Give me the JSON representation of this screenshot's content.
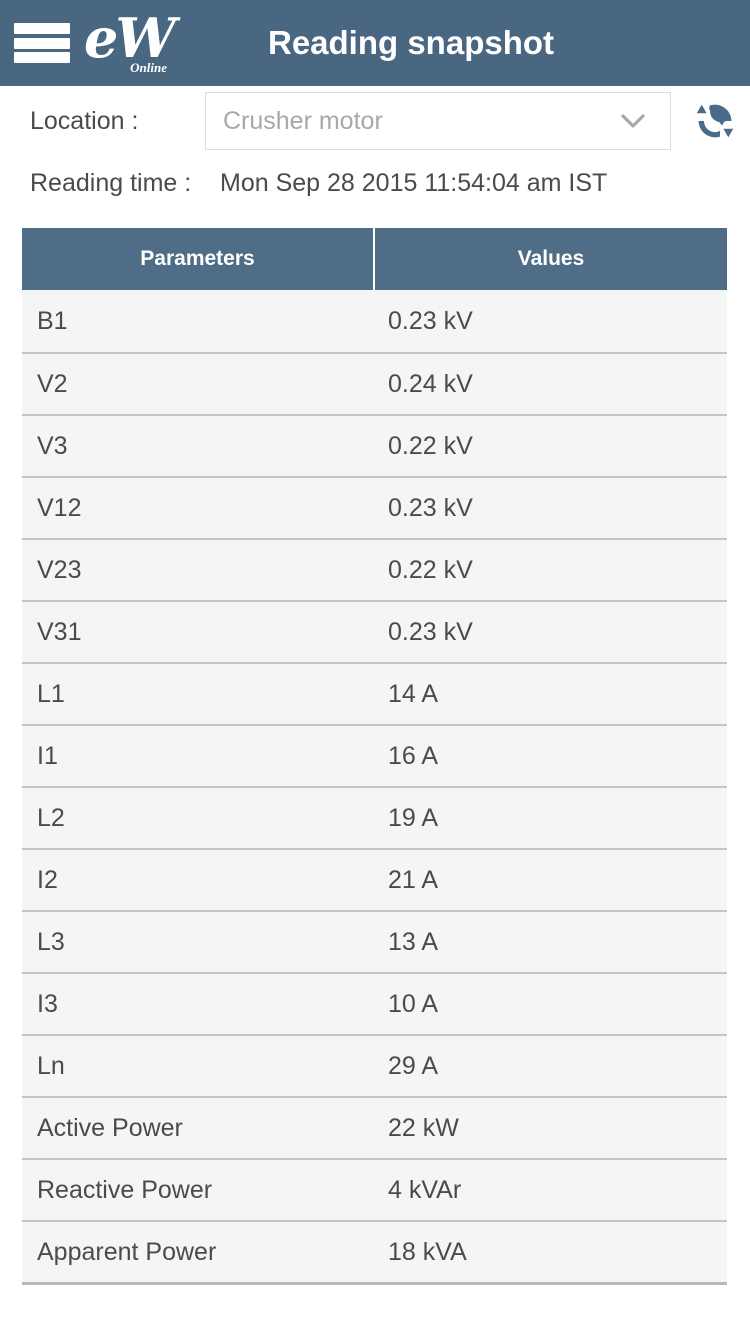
{
  "appbar": {
    "menu_icon": "hamburger-menu-icon",
    "logo_mark": "eW",
    "logo_sub": "Online",
    "title": "Reading snapshot"
  },
  "filters": {
    "location_label": "Location :",
    "location_value": "Crusher motor",
    "location_placeholder": "Crusher motor",
    "dropdown_icon": "chevron-down-icon",
    "refresh_icon": "refresh-icon",
    "reading_time_label": "Reading time :",
    "reading_time_value": "Mon Sep 28 2015 11:54:04 am IST"
  },
  "table": {
    "headers": [
      "Parameters",
      "Values"
    ],
    "rows": [
      {
        "parameter": "B1",
        "value": "0.23 kV"
      },
      {
        "parameter": "V2",
        "value": "0.24 kV"
      },
      {
        "parameter": "V3",
        "value": "0.22 kV"
      },
      {
        "parameter": "V12",
        "value": "0.23 kV"
      },
      {
        "parameter": "V23",
        "value": "0.22 kV"
      },
      {
        "parameter": "V31",
        "value": "0.23 kV"
      },
      {
        "parameter": "L1",
        "value": "14 A"
      },
      {
        "parameter": "I1",
        "value": "16 A"
      },
      {
        "parameter": "L2",
        "value": "19 A"
      },
      {
        "parameter": "I2",
        "value": "21 A"
      },
      {
        "parameter": "L3",
        "value": "13 A"
      },
      {
        "parameter": "I3",
        "value": "10 A"
      },
      {
        "parameter": "Ln",
        "value": "29 A"
      },
      {
        "parameter": "Active Power",
        "value": "22 kW"
      },
      {
        "parameter": "Reactive Power",
        "value": "4 kVAr"
      },
      {
        "parameter": "Apparent Power",
        "value": "18 kVA"
      }
    ]
  },
  "colors": {
    "appbar_bg": "#4a6781",
    "table_header_bg": "#4f6d86",
    "row_bg": "#f4f5f5",
    "row_border": "#c4c4c4",
    "text": "#4b4b4b",
    "placeholder": "#a8a8a8",
    "refresh_icon": "#4a6b89"
  }
}
